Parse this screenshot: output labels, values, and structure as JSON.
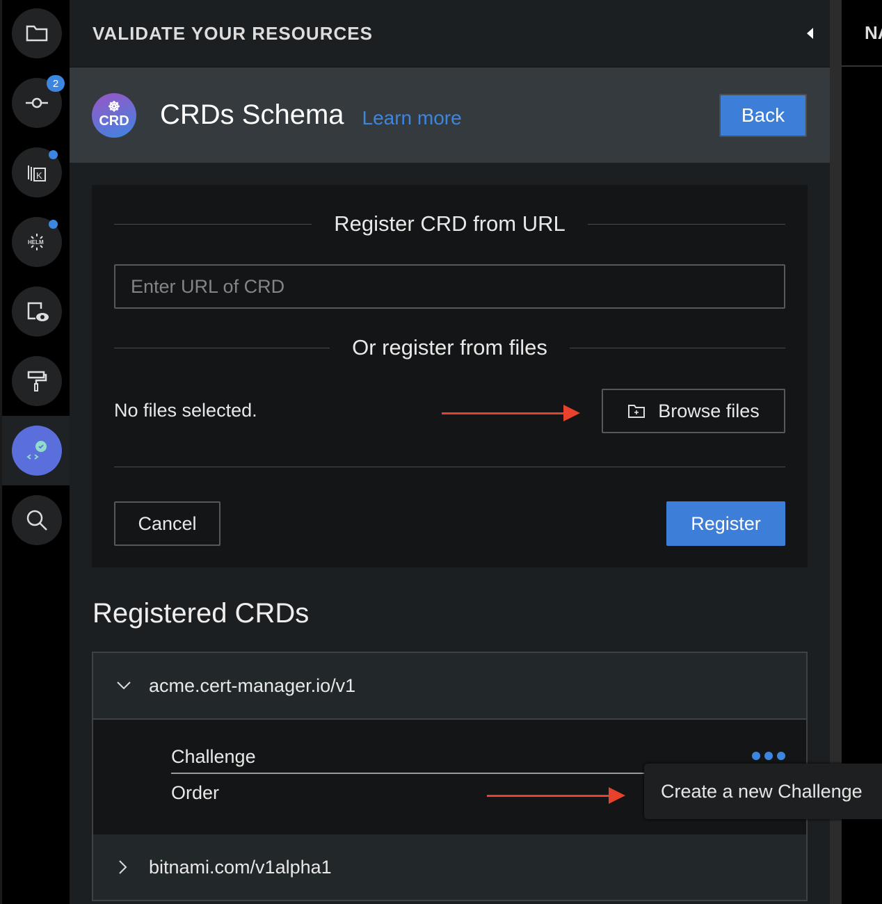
{
  "sidebar": {
    "items": [
      {
        "name": "folder-icon"
      },
      {
        "name": "git-commit-icon",
        "badge": "2"
      },
      {
        "name": "kustomize-icon",
        "dot": true
      },
      {
        "name": "helm-icon",
        "dot": true
      },
      {
        "name": "preview-icon"
      },
      {
        "name": "paint-roller-icon"
      },
      {
        "name": "validation-icon",
        "active": true
      },
      {
        "name": "search-replace-icon"
      }
    ],
    "helm_label": "HELM"
  },
  "header": {
    "title": "VALIDATE YOUR RESOURCES"
  },
  "right_panel": {
    "title": "NA"
  },
  "titlebar": {
    "logo_text": "CRD",
    "title": "CRDs Schema",
    "learn_more": "Learn more",
    "back": "Back"
  },
  "register": {
    "url_title": "Register CRD from URL",
    "url_placeholder": "Enter URL of CRD",
    "files_title": "Or register from files",
    "no_files": "No files selected.",
    "browse": "Browse files",
    "cancel": "Cancel",
    "register": "Register"
  },
  "registered": {
    "title": "Registered CRDs",
    "groups": [
      {
        "name": "acme.cert-manager.io/v1",
        "expanded": true,
        "items": [
          "Challenge",
          "Order"
        ]
      },
      {
        "name": "bitnami.com/v1alpha1",
        "expanded": false
      }
    ],
    "tooltip": "Create a new Challenge"
  },
  "colors": {
    "accent": "#3d7fd8",
    "arrow": "#e8412c"
  }
}
